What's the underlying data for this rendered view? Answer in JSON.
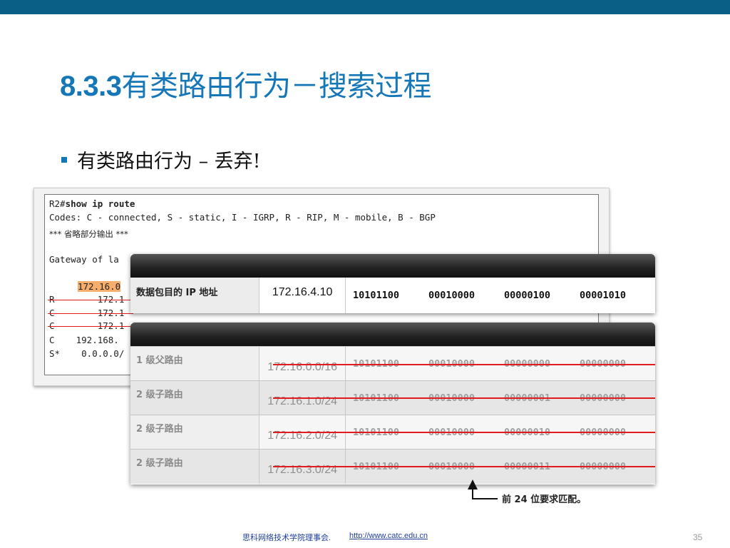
{
  "slide": {
    "title_number": "8.3.3",
    "title_text": "有类路由行为－搜索过程",
    "bullet": "有类路由行为 – 丢弃!",
    "accent_color": "#1677b8",
    "topbar_color": "#0a5f86"
  },
  "terminal": {
    "prompt": "R2#",
    "command": "show ip route",
    "codes_line": "Codes: C - connected, S - static, I - IGRP, R - RIP, M - mobile, B - BGP",
    "omitted": "*** 省略部分输出 ***",
    "gateway_line": "Gateway of la",
    "routes": [
      {
        "text": "172.16.0",
        "highlight": true
      },
      {
        "text": "R        172.1",
        "struck": true
      },
      {
        "text": "C        172.1",
        "struck": true
      },
      {
        "text": "C        172.1",
        "struck": true
      },
      {
        "text": "C    192.168.",
        "struck": false
      },
      {
        "text": "S*    0.0.0.0/",
        "struck": false
      }
    ]
  },
  "dest_panel": {
    "label": "数据包目的 IP 地址",
    "ip": "172.16.4.10",
    "octets": [
      "10101100",
      "00010000",
      "00000100",
      "00001010"
    ]
  },
  "route_panel": {
    "rows": [
      {
        "label": "1 级父路由",
        "ip": "172.16.0.0/16",
        "octets": [
          "10101100",
          "00010000",
          "00000000",
          "00000000"
        ]
      },
      {
        "label": "2 级子路由",
        "ip": "172.16.1.0/24",
        "octets": [
          "10101100",
          "00010000",
          "00000001",
          "00000000"
        ]
      },
      {
        "label": "2 级子路由",
        "ip": "172.16.2.0/24",
        "octets": [
          "10101100",
          "00010000",
          "00000010",
          "00000000"
        ]
      },
      {
        "label": "2 级子路由",
        "ip": "172.16.3.0/24",
        "octets": [
          "10101100",
          "00010000",
          "00000011",
          "00000000"
        ]
      }
    ]
  },
  "annotation": "前 24 位要求匹配。",
  "footer": {
    "org": "思科网络技术学院理事会.",
    "url": "http://www.catc.edu.cn",
    "page": "35"
  }
}
